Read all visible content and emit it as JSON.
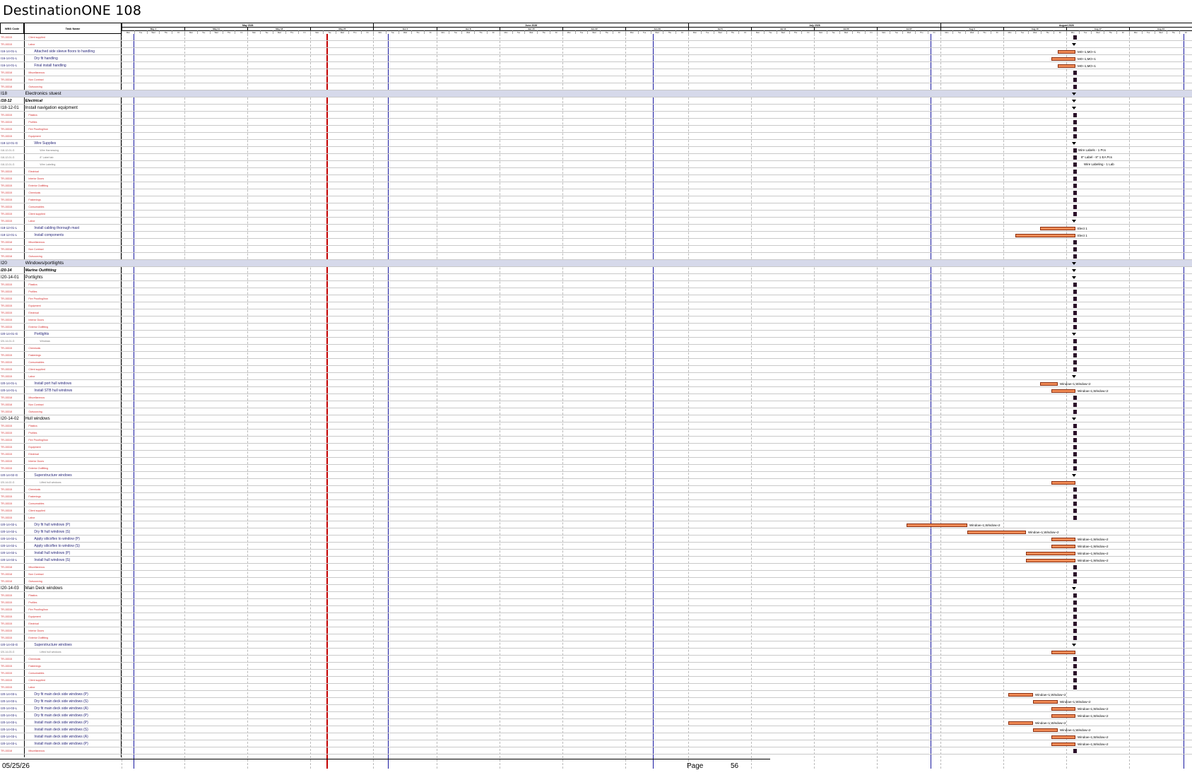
{
  "document": {
    "title": "DestinationONE 108",
    "columns": {
      "wbs": "WBS Code",
      "task": "Task Name"
    },
    "footer": {
      "date": "05/25/26",
      "page_label": "Page",
      "page_number": "56"
    }
  },
  "timeline": {
    "months": [
      "May 2026",
      "June 2026",
      "July 2026",
      "August 2026"
    ],
    "weeks": [
      "May 4",
      "May 11",
      "May 18",
      "May 25",
      "Jun 1",
      "Jun 8",
      "Jun 15",
      "Jun 22",
      "Jun 29",
      "Jul 6",
      "Jul 13",
      "Jul 20",
      "Jul 27",
      "Aug 3",
      "Aug 10",
      "Aug 17",
      "Aug 24"
    ],
    "days": [
      "Mon",
      "Tue",
      "Wed",
      "Thu",
      "Fri"
    ]
  },
  "tasks": [
    {
      "wbs": "TR-15315",
      "name": "Client supplied",
      "style": "red",
      "indent": 2
    },
    {
      "wbs": "TR-15315",
      "name": "Labor",
      "style": "red",
      "indent": 2
    },
    {
      "wbs": "I16-14-01-L",
      "name": "Attached side sleeve floors to handling",
      "style": "blue",
      "indent": 3,
      "bar": "l1"
    },
    {
      "wbs": "I16-14-01-L",
      "name": "Dry fit handling",
      "style": "blue",
      "indent": 3,
      "bar": "l2"
    },
    {
      "wbs": "I16-14-01-L",
      "name": "Final install handling",
      "style": "blue",
      "indent": 3,
      "bar": "l3"
    },
    {
      "wbs": "TR-15318",
      "name": "Miscellaneous",
      "style": "red",
      "indent": 2
    },
    {
      "wbs": "TR-15318",
      "name": "Non Contract",
      "style": "red",
      "indent": 2
    },
    {
      "wbs": "TR-15318",
      "name": "Outsourcing",
      "style": "red",
      "indent": 2
    },
    {
      "wbs": "I18",
      "name": "Electronics stuest",
      "style": "sect",
      "indent": 1
    },
    {
      "wbs": "I18-12",
      "name": "Electrical",
      "style": "sub",
      "indent": 1
    },
    {
      "wbs": "I18-12-01",
      "name": "Install navigation equipment",
      "style": "grp",
      "indent": 1
    },
    {
      "wbs": "TR-15315",
      "name": "Plastics",
      "style": "red",
      "indent": 2
    },
    {
      "wbs": "TR-15315",
      "name": "Profiles",
      "style": "red",
      "indent": 2
    },
    {
      "wbs": "TR-15315",
      "name": "Fire Proofing/Iron",
      "style": "red",
      "indent": 2
    },
    {
      "wbs": "TR-15315",
      "name": "Equipment",
      "style": "red",
      "indent": 2
    },
    {
      "wbs": "I18-12-01-G",
      "name": "Wire Supplies",
      "style": "blue",
      "indent": 3
    },
    {
      "wbs": "I18-12-01-G",
      "name": "Wire Harnessing",
      "style": "gray",
      "indent": 4
    },
    {
      "wbs": "I18-12-01-G",
      "name": "8\" Label tab",
      "style": "gray",
      "indent": 4
    },
    {
      "wbs": "I18-12-01-G",
      "name": "Wire Labeling",
      "style": "gray",
      "indent": 4
    },
    {
      "wbs": "TR-15315",
      "name": "Electrical",
      "style": "red",
      "indent": 2
    },
    {
      "wbs": "TR-15315",
      "name": "Interior Doors",
      "style": "red",
      "indent": 2
    },
    {
      "wbs": "TR-15315",
      "name": "Exterior Outfitting",
      "style": "red",
      "indent": 2
    },
    {
      "wbs": "TR-15315",
      "name": "Chemicals",
      "style": "red",
      "indent": 2
    },
    {
      "wbs": "TR-15315",
      "name": "Fastenings",
      "style": "red",
      "indent": 2
    },
    {
      "wbs": "TR-15315",
      "name": "Consumables",
      "style": "red",
      "indent": 2
    },
    {
      "wbs": "TR-15315",
      "name": "Client supplied",
      "style": "red",
      "indent": 2
    },
    {
      "wbs": "TR-15315",
      "name": "Labor",
      "style": "red",
      "indent": 2
    },
    {
      "wbs": "I18-12-01-L",
      "name": "Install cabling thorough mast",
      "style": "blue",
      "indent": 3,
      "bar": "e1"
    },
    {
      "wbs": "I18-12-01-L",
      "name": "Install components",
      "style": "blue",
      "indent": 3,
      "bar": "e2"
    },
    {
      "wbs": "TR-15318",
      "name": "Miscellaneous",
      "style": "red",
      "indent": 2
    },
    {
      "wbs": "TR-15318",
      "name": "Non Contract",
      "style": "red",
      "indent": 2
    },
    {
      "wbs": "TR-15318",
      "name": "Outsourcing",
      "style": "red",
      "indent": 2
    },
    {
      "wbs": "I20",
      "name": "Windows/portlights",
      "style": "sect",
      "indent": 1
    },
    {
      "wbs": "I20-14",
      "name": "Marine Outfitting",
      "style": "sub",
      "indent": 1
    },
    {
      "wbs": "I20-14-01",
      "name": "Portlights",
      "style": "grp",
      "indent": 1
    },
    {
      "wbs": "TR-15315",
      "name": "Plastics",
      "style": "red",
      "indent": 2
    },
    {
      "wbs": "TR-15315",
      "name": "Profiles",
      "style": "red",
      "indent": 2
    },
    {
      "wbs": "TR-15315",
      "name": "Fire Proofing/Iron",
      "style": "red",
      "indent": 2
    },
    {
      "wbs": "TR-15315",
      "name": "Equipment",
      "style": "red",
      "indent": 2
    },
    {
      "wbs": "TR-15315",
      "name": "Electrical",
      "style": "red",
      "indent": 2
    },
    {
      "wbs": "TR-15315",
      "name": "Interior Doors",
      "style": "red",
      "indent": 2
    },
    {
      "wbs": "TR-15315",
      "name": "Exterior Outfitting",
      "style": "red",
      "indent": 2
    },
    {
      "wbs": "I20-14-01-G",
      "name": "Portlights",
      "style": "blue",
      "indent": 3
    },
    {
      "wbs": "I20-14-01-G",
      "name": "Windows",
      "style": "gray",
      "indent": 4
    },
    {
      "wbs": "TR-15315",
      "name": "Chemicals",
      "style": "red",
      "indent": 2
    },
    {
      "wbs": "TR-15315",
      "name": "Fastenings",
      "style": "red",
      "indent": 2
    },
    {
      "wbs": "TR-15315",
      "name": "Consumables",
      "style": "red",
      "indent": 2
    },
    {
      "wbs": "TR-15315",
      "name": "Client supplied",
      "style": "red",
      "indent": 2
    },
    {
      "wbs": "TR-15315",
      "name": "Labor",
      "style": "red",
      "indent": 2
    },
    {
      "wbs": "I20-14-01-L",
      "name": "Install port hull windows",
      "style": "blue",
      "indent": 3,
      "bar": "p1"
    },
    {
      "wbs": "I20-14-01-L",
      "name": "Install STB hull windows",
      "style": "blue",
      "indent": 3,
      "bar": "p2"
    },
    {
      "wbs": "TR-15318",
      "name": "Miscellaneous",
      "style": "red",
      "indent": 2
    },
    {
      "wbs": "TR-15318",
      "name": "Non Contract",
      "style": "red",
      "indent": 2
    },
    {
      "wbs": "TR-15318",
      "name": "Outsourcing",
      "style": "red",
      "indent": 2
    },
    {
      "wbs": "I20-14-02",
      "name": "Hull windows",
      "style": "grp",
      "indent": 1
    },
    {
      "wbs": "TR-15315",
      "name": "Plastics",
      "style": "red",
      "indent": 2
    },
    {
      "wbs": "TR-15315",
      "name": "Profiles",
      "style": "red",
      "indent": 2
    },
    {
      "wbs": "TR-15315",
      "name": "Fire Proofing/Iron",
      "style": "red",
      "indent": 2
    },
    {
      "wbs": "TR-15315",
      "name": "Equipment",
      "style": "red",
      "indent": 2
    },
    {
      "wbs": "TR-15315",
      "name": "Electrical",
      "style": "red",
      "indent": 2
    },
    {
      "wbs": "TR-15315",
      "name": "Interior Doors",
      "style": "red",
      "indent": 2
    },
    {
      "wbs": "TR-15315",
      "name": "Exterior Outfitting",
      "style": "red",
      "indent": 2
    },
    {
      "wbs": "I20-14-02-G",
      "name": "Superstructure windows",
      "style": "blue",
      "indent": 3
    },
    {
      "wbs": "I20-14-02-G",
      "name": "Lifted hull windows",
      "style": "gray",
      "indent": 4,
      "bar": "h0"
    },
    {
      "wbs": "TR-15315",
      "name": "Chemicals",
      "style": "red",
      "indent": 2
    },
    {
      "wbs": "TR-15315",
      "name": "Fastenings",
      "style": "red",
      "indent": 2
    },
    {
      "wbs": "TR-15315",
      "name": "Consumables",
      "style": "red",
      "indent": 2
    },
    {
      "wbs": "TR-15315",
      "name": "Client supplied",
      "style": "red",
      "indent": 2
    },
    {
      "wbs": "TR-15315",
      "name": "Labor",
      "style": "red",
      "indent": 2
    },
    {
      "wbs": "I20-14-02-L",
      "name": "Dry fit hull windows (P)",
      "style": "blue",
      "indent": 3,
      "bar": "h1"
    },
    {
      "wbs": "I20-14-02-L",
      "name": "Dry fit hull windows (S)",
      "style": "blue",
      "indent": 3,
      "bar": "h2"
    },
    {
      "wbs": "I20-14-02-L",
      "name": "Apply silicoflex to window (P)",
      "style": "blue",
      "indent": 3,
      "bar": "h3"
    },
    {
      "wbs": "I20-14-02-L",
      "name": "Apply silicoflex to window (S)",
      "style": "blue",
      "indent": 3,
      "bar": "h4"
    },
    {
      "wbs": "I20-14-02-L",
      "name": "Install hull windows (P)",
      "style": "blue",
      "indent": 3,
      "bar": "h5"
    },
    {
      "wbs": "I20-14-02-L",
      "name": "Install hull windows (S)",
      "style": "blue",
      "indent": 3,
      "bar": "h6"
    },
    {
      "wbs": "TR-15318",
      "name": "Miscellaneous",
      "style": "red",
      "indent": 2
    },
    {
      "wbs": "TR-15318",
      "name": "Non Contract",
      "style": "red",
      "indent": 2
    },
    {
      "wbs": "TR-15318",
      "name": "Outsourcing",
      "style": "red",
      "indent": 2
    },
    {
      "wbs": "I20-14-03",
      "name": "Main Deck windows",
      "style": "grp",
      "indent": 1
    },
    {
      "wbs": "TR-15315",
      "name": "Plastics",
      "style": "red",
      "indent": 2
    },
    {
      "wbs": "TR-15315",
      "name": "Profiles",
      "style": "red",
      "indent": 2
    },
    {
      "wbs": "TR-15315",
      "name": "Fire Proofing/Iron",
      "style": "red",
      "indent": 2
    },
    {
      "wbs": "TR-15315",
      "name": "Equipment",
      "style": "red",
      "indent": 2
    },
    {
      "wbs": "TR-15315",
      "name": "Electrical",
      "style": "red",
      "indent": 2
    },
    {
      "wbs": "TR-15315",
      "name": "Interior Doors",
      "style": "red",
      "indent": 2
    },
    {
      "wbs": "TR-15315",
      "name": "Exterior Outfitting",
      "style": "red",
      "indent": 2
    },
    {
      "wbs": "I20-14-03-G",
      "name": "Superstructure windows",
      "style": "blue",
      "indent": 3
    },
    {
      "wbs": "I20-14-03-G",
      "name": "Lifted hull windows",
      "style": "gray",
      "indent": 4,
      "bar": "m0"
    },
    {
      "wbs": "TR-15315",
      "name": "Chemicals",
      "style": "red",
      "indent": 2
    },
    {
      "wbs": "TR-15315",
      "name": "Fastenings",
      "style": "red",
      "indent": 2
    },
    {
      "wbs": "TR-15315",
      "name": "Consumables",
      "style": "red",
      "indent": 2
    },
    {
      "wbs": "TR-15315",
      "name": "Client supplied",
      "style": "red",
      "indent": 2
    },
    {
      "wbs": "TR-15315",
      "name": "Labor",
      "style": "red",
      "indent": 2
    },
    {
      "wbs": "I20-14-03-L",
      "name": "Dry fit main deck side windows (P)",
      "style": "blue",
      "indent": 3,
      "bar": "m1"
    },
    {
      "wbs": "I20-14-03-L",
      "name": "Dry fit main deck side windows (S)",
      "style": "blue",
      "indent": 3,
      "bar": "m2"
    },
    {
      "wbs": "I20-14-03-L",
      "name": "Dry fit main deck side windows (A)",
      "style": "blue",
      "indent": 3,
      "bar": "m3"
    },
    {
      "wbs": "I20-14-03-L",
      "name": "Dry fit main deck side windows (P)",
      "style": "blue",
      "indent": 3,
      "bar": "m4"
    },
    {
      "wbs": "I20-14-03-L",
      "name": "Install main deck side windows (P)",
      "style": "blue",
      "indent": 3,
      "bar": "m5"
    },
    {
      "wbs": "I20-14-03-L",
      "name": "Install main deck side windows (S)",
      "style": "blue",
      "indent": 3,
      "bar": "m6"
    },
    {
      "wbs": "I20-14-03-L",
      "name": "Install main deck side windows (A)",
      "style": "blue",
      "indent": 3,
      "bar": "m7"
    },
    {
      "wbs": "I20-14-03-L",
      "name": "Install main deck side windows (P)",
      "style": "blue",
      "indent": 3,
      "bar": "m8"
    },
    {
      "wbs": "TR-15318",
      "name": "Miscellaneous",
      "style": "red",
      "indent": 2
    }
  ],
  "bar_labels": {
    "l1": "MO~1,MO~1",
    "l2": "MO~1,MO~1",
    "l3": "MO~1,MO~1",
    "e1": "Elect 1",
    "e2": "Elect 1",
    "p1": "Window~1,Window~2",
    "p2": "Window~1,Window~2",
    "h1": "Window~1,Window~2",
    "h2": "Window~1,Window~2",
    "h3": "Window~1,Window~2",
    "h4": "Window~1,Window~2",
    "h5": "Window~1,Window~2",
    "h6": "Window~1,Window~2",
    "m1": "Window~1,Window~2",
    "m2": "Window~1,Window~2",
    "m3": "Window~1,Window~2",
    "m4": "Window~1,Window~2",
    "m5": "Window~1,Window~2",
    "m6": "Window~1,Window~2",
    "m7": "Window~1,Window~2",
    "m8": "Window~1,Window~2"
  },
  "wire_labels": [
    "Wire Labels - 1 Pcs",
    "8\" Label - 8\" 1 EA Pcs",
    "Wire Labeling - 1 Lab"
  ],
  "colors": {
    "bar_fill": "#f08a55",
    "bar_border": "#8b2f10",
    "status_line": "#c40000",
    "week_line": "#1a1aa0",
    "milestone": "#2a0f28",
    "section_bg": "#d6d9ea"
  }
}
